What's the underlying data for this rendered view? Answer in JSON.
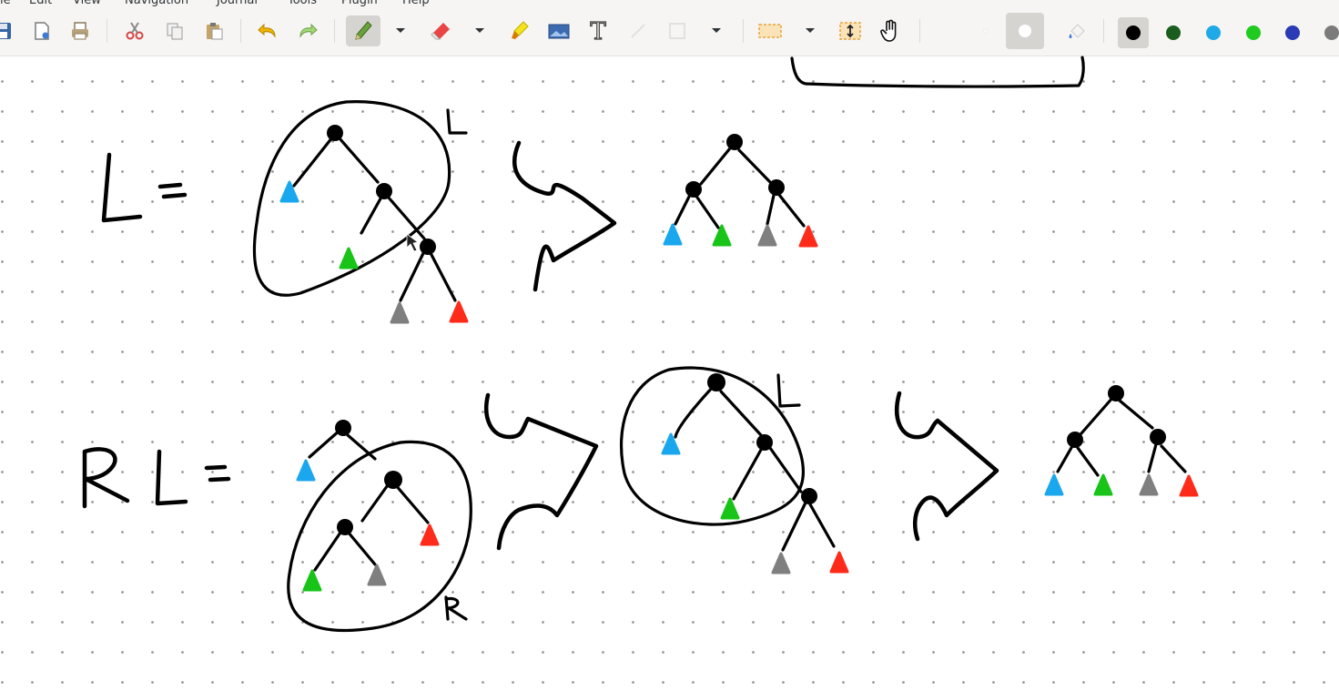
{
  "menu": [
    "le",
    "Edit",
    "View",
    "Navigation",
    "Journal",
    "Tools",
    "Plugin",
    "Help"
  ],
  "toolbar": {
    "tools": [
      {
        "id": "save",
        "icon": "save-icon"
      },
      {
        "id": "new-page",
        "icon": "new-page-icon"
      },
      {
        "id": "print",
        "icon": "print-icon"
      },
      {
        "id": "cut",
        "icon": "scissors-icon"
      },
      {
        "id": "copy",
        "icon": "copy-icon"
      },
      {
        "id": "paste",
        "icon": "paste-icon"
      },
      {
        "id": "undo",
        "icon": "undo-icon"
      },
      {
        "id": "redo",
        "icon": "redo-icon"
      },
      {
        "id": "pen",
        "icon": "pen-icon",
        "active": true
      },
      {
        "id": "eraser",
        "icon": "eraser-icon"
      },
      {
        "id": "highlighter",
        "icon": "highlighter-icon"
      },
      {
        "id": "image",
        "icon": "image-icon"
      },
      {
        "id": "text",
        "icon": "text-icon"
      },
      {
        "id": "select-rect",
        "icon": "select-rectangle-icon"
      },
      {
        "id": "vertical-space",
        "icon": "vertical-space-icon"
      },
      {
        "id": "hand",
        "icon": "hand-icon"
      },
      {
        "id": "fill",
        "icon": "fill-icon"
      }
    ],
    "text_tool_glyph": "T",
    "colors": [
      {
        "name": "black",
        "hex": "#000000",
        "selected": true
      },
      {
        "name": "dark-green",
        "hex": "#1a5d1f"
      },
      {
        "name": "light-blue",
        "hex": "#1fa9e6"
      },
      {
        "name": "green",
        "hex": "#1ecb1e"
      },
      {
        "name": "blue",
        "hex": "#2b3ab5"
      },
      {
        "name": "gray",
        "hex": "#7b7b7b"
      }
    ]
  },
  "accent_colors": {
    "blue_subtree": "#1aa7ee",
    "green_subtree": "#17c417",
    "gray_subtree": "#7f7f7f",
    "red_subtree": "#ff2b1a"
  }
}
